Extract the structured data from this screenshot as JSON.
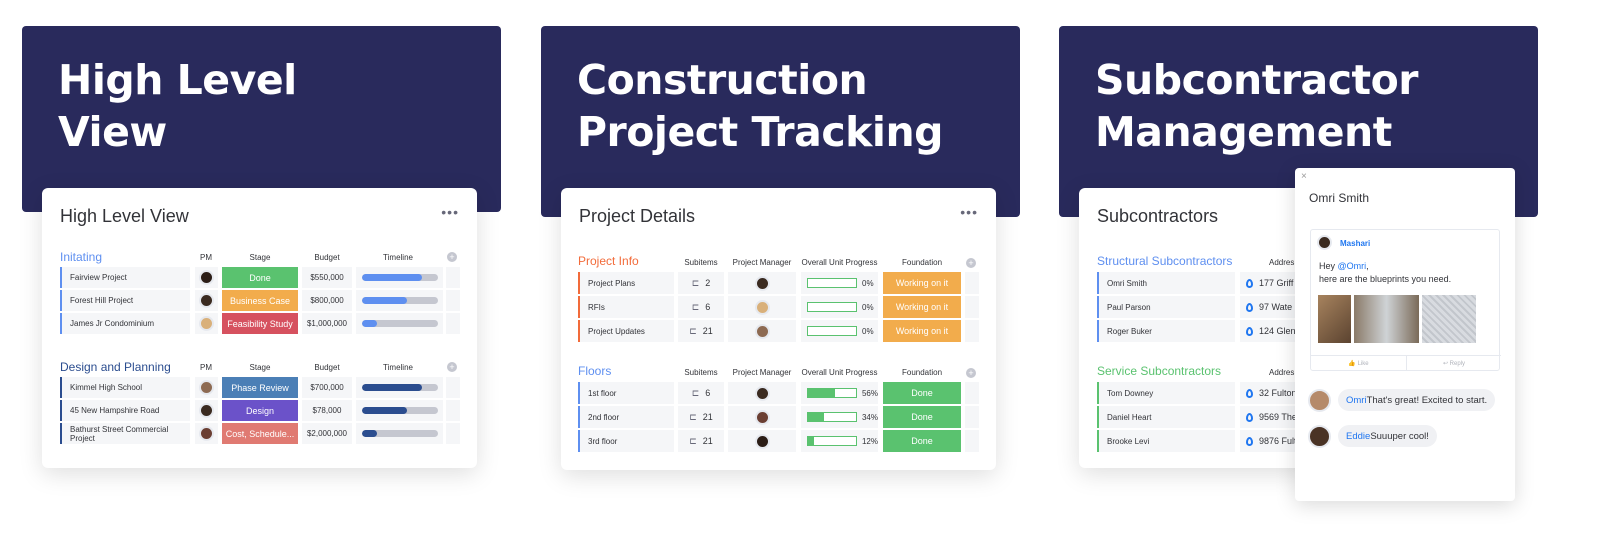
{
  "banners": [
    "High Level\nView",
    "Construction\nProject Tracking",
    "Subcontractor\nManagement"
  ],
  "colors": {
    "banner": "#292a5c",
    "done": "#5ac26f",
    "working": "#f2ac4c",
    "stuck": "#d6515f",
    "blue": "#1f76f0"
  },
  "high_level": {
    "title": "High Level View",
    "menu": "•••",
    "headers": [
      "PM",
      "Stage",
      "Budget",
      "Timeline"
    ],
    "groups": [
      {
        "title": "Initating",
        "color": "#5e8ff0",
        "bar": "#5e8ff0",
        "rows": [
          {
            "name": "Fairview Project",
            "stage": "Done",
            "stage_color": "#5ac26f",
            "budget": "$550,000",
            "timeline": 0.8
          },
          {
            "name": "Forest Hill Project",
            "stage": "Business Case",
            "stage_color": "#f2ac4c",
            "budget": "$800,000",
            "timeline": 0.6
          },
          {
            "name": "James Jr Condominium",
            "stage": "Feasibility Study",
            "stage_color": "#d6515f",
            "budget": "$1,000,000",
            "timeline": 0.2
          }
        ]
      },
      {
        "title": "Design and Planning",
        "color": "#2b4d8f",
        "bar": "#2b4d8f",
        "rows": [
          {
            "name": "Kimmel High School",
            "stage": "Phase Review",
            "stage_color": "#4b7fb6",
            "budget": "$700,000",
            "timeline": 0.8
          },
          {
            "name": "45 New Hampshire Road",
            "stage": "Design",
            "stage_color": "#6b52c9",
            "budget": "$78,000",
            "timeline": 0.6
          },
          {
            "name": "Bathurst Street Commercial Project",
            "stage": "Cost, Schedule...",
            "stage_color": "#e07a72",
            "budget": "$2,000,000",
            "timeline": 0.2
          }
        ]
      }
    ]
  },
  "project": {
    "title": "Project Details",
    "menu": "•••",
    "headers": [
      "Subitems",
      "Project Manager",
      "Overall Unit Progress",
      "Foundation"
    ],
    "groups": [
      {
        "title": "Project Info",
        "color": "#f26b3a",
        "rows": [
          {
            "name": "Project Plans",
            "subitems": "2",
            "progress": "0%",
            "progress_value": 0,
            "foundation": "Working on it",
            "foundation_color": "#f2ac4c"
          },
          {
            "name": "RFIs",
            "subitems": "6",
            "progress": "0%",
            "progress_value": 0,
            "foundation": "Working on it",
            "foundation_color": "#f2ac4c"
          },
          {
            "name": "Project Updates",
            "subitems": "21",
            "progress": "0%",
            "progress_value": 0,
            "foundation": "Working on it",
            "foundation_color": "#f2ac4c"
          }
        ]
      },
      {
        "title": "Floors",
        "color": "#5e8ff0",
        "rows": [
          {
            "name": "1st floor",
            "subitems": "6",
            "progress": "56%",
            "progress_value": 56,
            "foundation": "Done",
            "foundation_color": "#5ac26f"
          },
          {
            "name": "2nd floor",
            "subitems": "21",
            "progress": "34%",
            "progress_value": 34,
            "foundation": "Done",
            "foundation_color": "#5ac26f"
          },
          {
            "name": "3rd floor",
            "subitems": "21",
            "progress": "12%",
            "progress_value": 12,
            "foundation": "Done",
            "foundation_color": "#5ac26f"
          }
        ]
      }
    ]
  },
  "subs": {
    "title": "Subcontractors",
    "groups": [
      {
        "title": "Structural Subcontractors",
        "color": "#5e8ff0",
        "address_header": "Addres",
        "rows": [
          {
            "name": "Omri Smith",
            "address": "177 Griff"
          },
          {
            "name": "Paul Parson",
            "address": "97  Wate"
          },
          {
            "name": "Roger Buker",
            "address": "124 Glen"
          }
        ]
      },
      {
        "title": "Service Subcontractors",
        "color": "#5ac26f",
        "address_header": "Addres",
        "rows": [
          {
            "name": "Tom Downey",
            "address": "32 Fulton"
          },
          {
            "name": "Daniel Heart",
            "address": "9569 The"
          },
          {
            "name": "Brooke Levi",
            "address": "9876 Fult"
          }
        ]
      }
    ]
  },
  "chat": {
    "close": "×",
    "title": "Omri Smith",
    "post": {
      "author": "Mashari",
      "greeting": "Hey ",
      "mention": "@Omri",
      "comma": ",",
      "body": "here are the blueprints you need.",
      "like": "Like",
      "reply": "Reply"
    },
    "replies": [
      {
        "author": "Omri",
        "text": " That's great! Excited to start."
      },
      {
        "author": "Eddie",
        "text": " Suuuper cool!"
      }
    ]
  }
}
